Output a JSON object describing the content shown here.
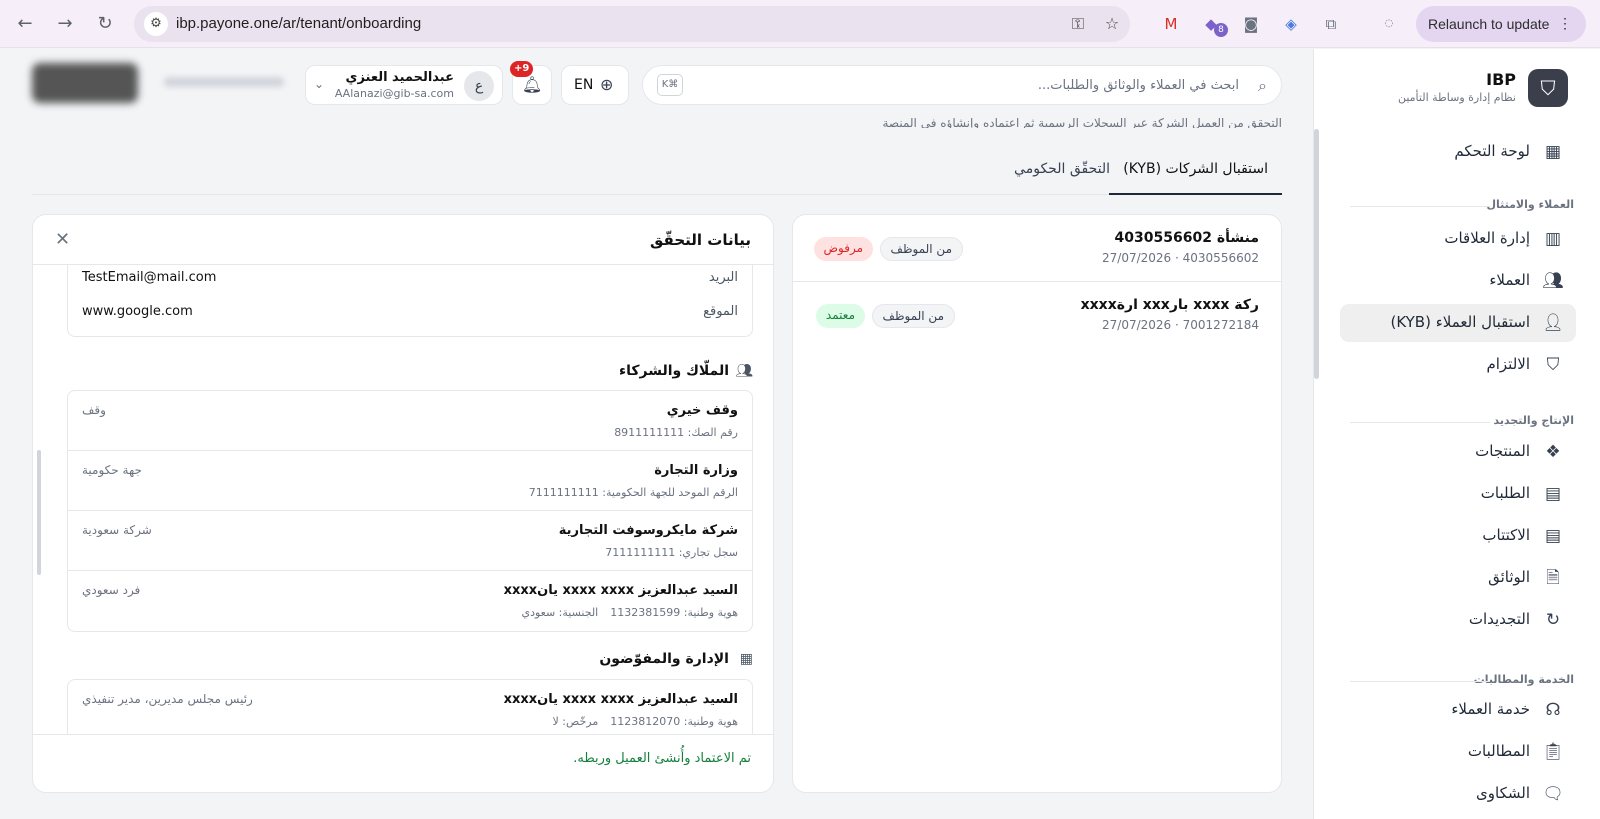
{
  "browser": {
    "url": "ibp.payone.one/ar/tenant/onboarding",
    "relaunch_label": "Relaunch to update",
    "ext_badge": "8"
  },
  "brand": {
    "name": "IBP",
    "subtitle": "نظام إدارة وساطة التأمين"
  },
  "sidebar": {
    "dashboard": "لوحة التحكم",
    "section_customers": "العملاء والامتثال",
    "relations": "إدارة العلاقات",
    "customers": "العملاء",
    "kyb": "استقبال العملاء (KYB)",
    "compliance": "الالتزام",
    "section_production": "الإنتاج والتجديد",
    "products": "المنتجات",
    "requests": "الطلبات",
    "underwriting": "الاكتتاب",
    "policies": "الوثائق",
    "renewals": "التجديدات",
    "section_service": "الخدمة والمطالبات",
    "customer_service": "خدمة العملاء",
    "claims": "المطالبات",
    "complaints": "الشكاوى"
  },
  "header": {
    "user_name": "عبدالحميد العنزي",
    "user_email": "AAlanazi@gib-sa.com",
    "user_initial": "ع",
    "notif_count": "+9",
    "lang": "EN",
    "search_placeholder": "ابحث في العملاء والوثائق والطلبات...",
    "search_kbd": "K⌘"
  },
  "page": {
    "description": "التحقق من العميل الشركة عبر السجلات الرسمية ثم اعتماده وإنشاؤه في المنصة",
    "tab_kyb": "استقبال الشركات (KYB)",
    "tab_gov": "التحقّق الحكومي"
  },
  "list": [
    {
      "title": "منشأة 4030556602",
      "sub": "4030556602 · 27/07/2026",
      "source": "من الموظف",
      "status": "مرفوض",
      "status_type": "rejected"
    },
    {
      "title": "ركة xxxx بارxxx ارةxxxx",
      "sub": "7001272184 · 27/07/2026",
      "source": "من الموظف",
      "status": "معتمد",
      "status_type": "approved"
    }
  ],
  "detail": {
    "title": "بيانات التحقّق",
    "email_label": "البريد",
    "email_value": "TestEmail@mail.com",
    "site_label": "الموقع",
    "site_value": "www.google.com",
    "owners_title": "الملّاك والشركاء",
    "owners": [
      {
        "name": "وقف خيري",
        "meta1": "رقم الصك: 8911111111",
        "meta2": "",
        "type": "وقف"
      },
      {
        "name": "وزارة التجارة",
        "meta1": "الرقم الموحد للجهة الحكومية: 7111111111",
        "meta2": "",
        "type": "جهة حكومية"
      },
      {
        "name": "شركة مايكروسوفت التجارية",
        "meta1": "سجل تجاري: 7111111111",
        "meta2": "",
        "type": "شركة سعودية"
      },
      {
        "name": "السيد عبدالعزيز xxxx xxxx يانxxxx",
        "meta1": "هوية وطنية: 1132381599",
        "meta2": "الجنسية: سعودي",
        "type": "فرد سعودي"
      }
    ],
    "mgmt_title": "الإدارة والمفوّضون",
    "mgmt": [
      {
        "name": "السيد عبدالعزيز xxxx xxxx يانxxxx",
        "meta1": "هوية وطنية: 1123812070",
        "meta2": "مرخّص: لا",
        "type": "رئيس مجلس مديرين، مدير تنفيذي"
      }
    ],
    "footer": "تم الاعتماد وأُنشئ العميل وربطه."
  }
}
